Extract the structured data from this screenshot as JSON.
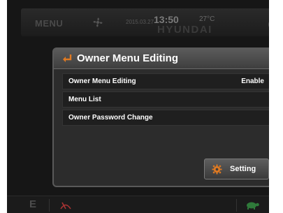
{
  "topbar": {
    "menu_label": "MENU",
    "fan_icon": "fan-icon",
    "date": "2015.03.27",
    "time": "13:50",
    "temperature": "27°C",
    "brand": "HYUNDAI",
    "gauge_icon": "gauge-icon"
  },
  "dialog": {
    "title": "Owner Menu Editing",
    "back_icon": "back-arrow-icon",
    "rows": [
      {
        "label": "Owner Menu Editing",
        "value": "Enable"
      },
      {
        "label": "Menu List"
      },
      {
        "label": "Owner Password Change"
      }
    ],
    "setting_button": {
      "label": "Setting",
      "icon": "gear-icon"
    },
    "colors": {
      "accent": "#e07a22",
      "header": "#4a4a4a",
      "row_bg": "#1f1f1f"
    }
  },
  "bottombar": {
    "mode_label": "E",
    "wiper_icon": "wiper-icon",
    "turtle_icon": "turtle-icon",
    "colors": {
      "turtle": "#2f7a3a",
      "wiper": "#c03030"
    }
  }
}
